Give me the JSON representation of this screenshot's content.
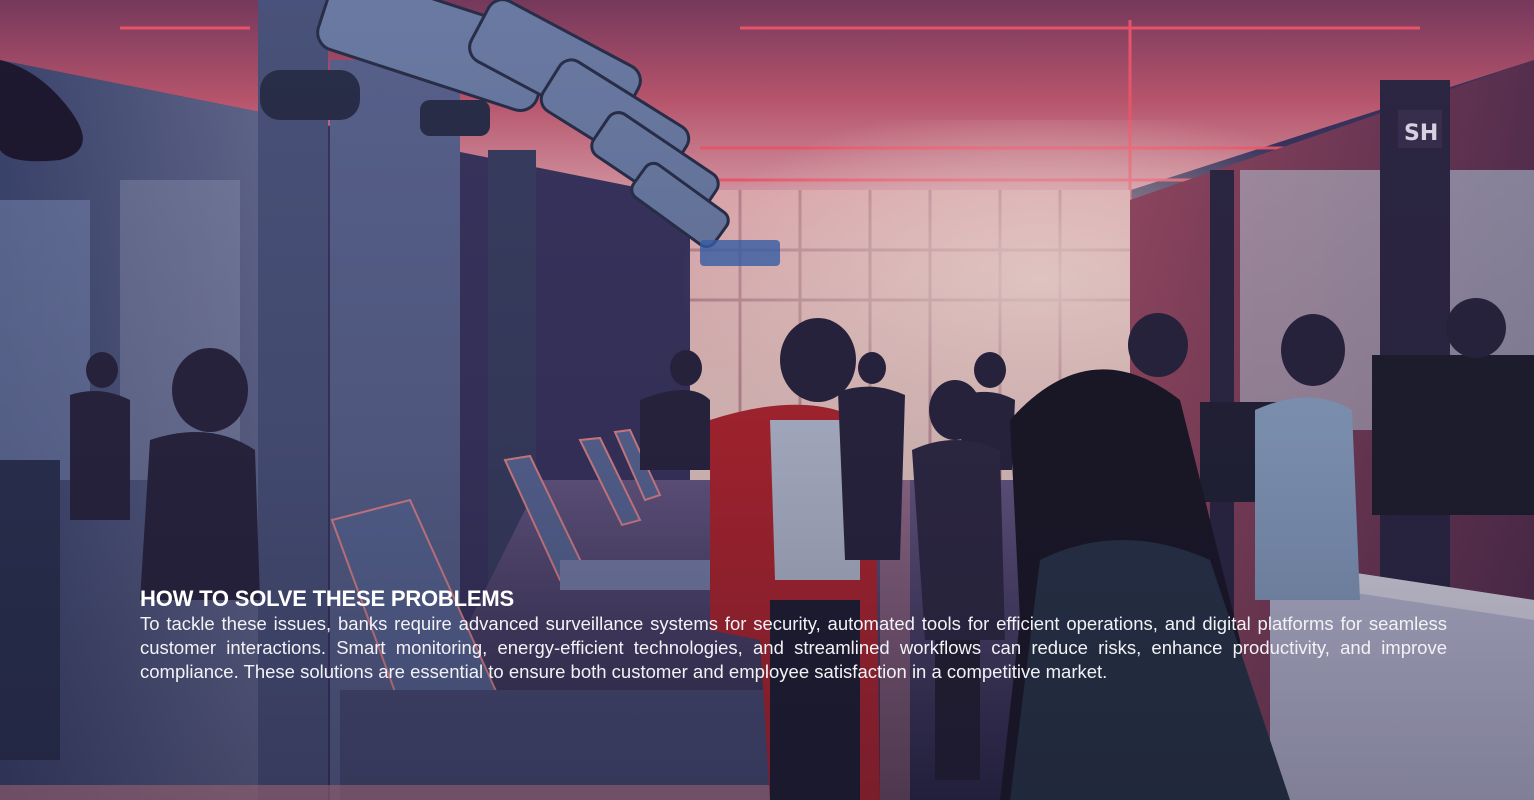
{
  "section": {
    "title": "HOW TO SOLVE THESE PROBLEMS",
    "body": "To tackle these issues, banks require advanced surveillance systems for security, automated tools for efficient operations, and digital platforms for seamless customer interactions. Smart monitoring, energy-efficient technologies, and streamlined workflows can reduce risks, enhance productivity, and improve compliance. These solutions are essential to ensure both customer and employee satisfaction in a competitive market."
  },
  "colors": {
    "text": "#ffffff",
    "neon_accent": "#ff5a6e",
    "overlay": "#1b1a2e"
  }
}
